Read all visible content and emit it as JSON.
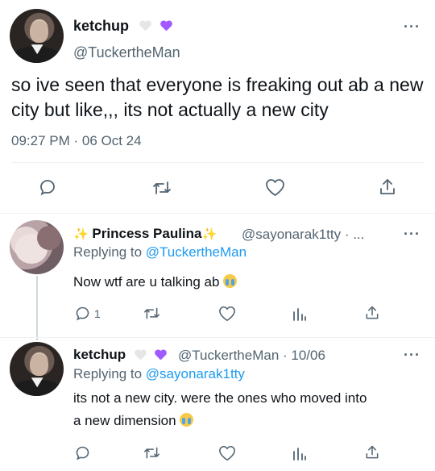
{
  "main_tweet": {
    "display_name": "ketchup",
    "handle": "@TuckertheMan",
    "text": "so ive seen that everyone is freaking out ab a new city but like,,, its not actually a new city",
    "timestamp": "09:27 PM · 06 Oct 24",
    "more": "···",
    "heart_colors": [
      "#e6e6e6",
      "#a259ff"
    ]
  },
  "reply_1": {
    "sparkle_left": "✨",
    "display_name": "Princess Paulina",
    "sparkle_right": "✨",
    "handle": "@sayonarak1tty · ...",
    "replying_label": "Replying to",
    "replying_to": "@TuckertheMan",
    "text": "Now wtf are u talking ab",
    "reply_count": "1",
    "more": "···"
  },
  "reply_2": {
    "display_name": "ketchup",
    "handle": "@TuckertheMan · 10/06",
    "replying_label": "Replying to",
    "replying_to": "@sayonarak1tty",
    "text_line1": "its not a new city. were the ones who moved into",
    "text_line2": "a new dimension",
    "more": "···",
    "heart_colors": [
      "#e6e6e6",
      "#a259ff"
    ]
  },
  "icons": {
    "reply": "reply-icon",
    "retweet": "retweet-icon",
    "like": "like-icon",
    "share": "share-icon",
    "views": "views-icon"
  },
  "colors": {
    "text": "#0f1419",
    "secondary": "#536471",
    "link": "#1d9bf0",
    "divider": "#eff3f4"
  }
}
